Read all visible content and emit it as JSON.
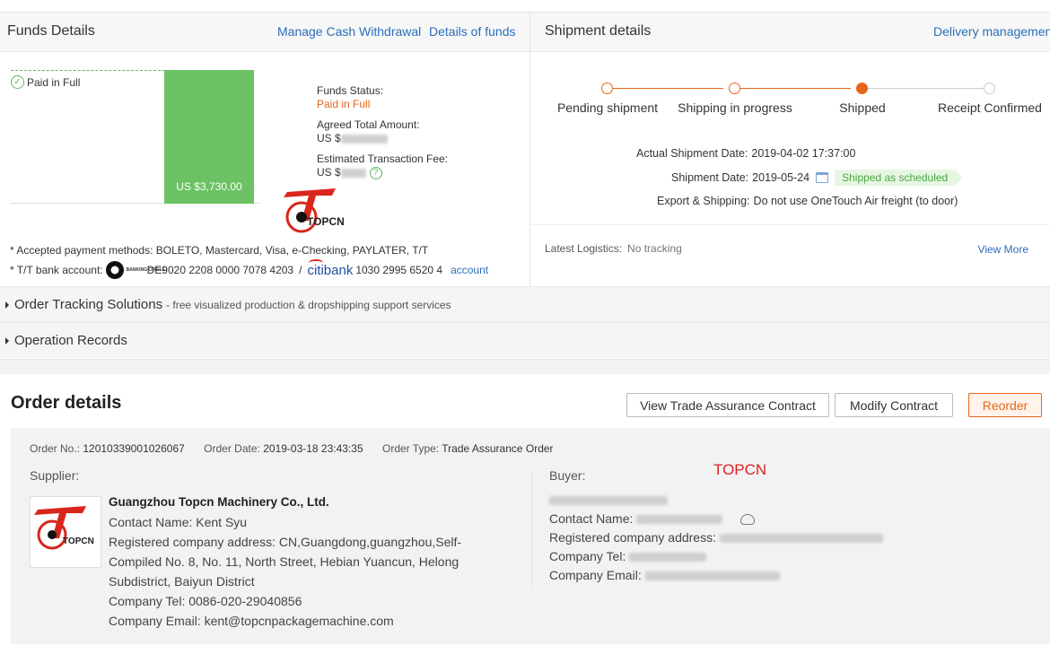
{
  "funds": {
    "title": "Funds Details",
    "link_withdrawal": "Manage Cash Withdrawal",
    "link_details": "Details of funds",
    "paid_badge": "Paid in Full",
    "bar_label": "US $3,730.00",
    "status_label": "Funds Status:",
    "status_value": "Paid in Full",
    "agreed_label": "Agreed Total Amount:",
    "agreed_prefix": "US $",
    "fee_label": "Estimated Transaction Fee:",
    "fee_prefix": "US $",
    "logo_text": "TOPCN",
    "payment_methods": "* Accepted payment methods: BOLETO, Mastercard, Visa, e-Checking, PAYLATER, T/T",
    "bank_label": "* T/T bank account:",
    "banking_circle": "BANKING CIRCLE",
    "iban": "DE9020 2208 0000 7078 4203",
    "bank_sep": "/",
    "citibank": "citibank",
    "citi_acct": "1030 2995 6520 4",
    "account_link": "account"
  },
  "shipment": {
    "title": "Shipment details",
    "link_delivery": "Delivery management",
    "steps": [
      "Pending shipment",
      "Shipping in progress",
      "Shipped",
      "Receipt Confirmed"
    ],
    "actual_label": "Actual Shipment Date:",
    "actual_value": "2019-04-02 17:37:00",
    "date_label": "Shipment Date:",
    "date_value": "2019-05-24",
    "scheduled_badge": "Shipped as scheduled",
    "export_label": "Export & Shipping:",
    "export_value": "Do not use OneTouch Air freight (to door)",
    "logistics_label": "Latest Logistics:",
    "logistics_value": "No tracking",
    "view_more": "View More"
  },
  "sections": {
    "tracking_title": "Order Tracking Solutions",
    "tracking_sub": "- free visualized production & dropshipping support services",
    "records_title": "Operation Records"
  },
  "order": {
    "title": "Order details",
    "btn_view_contract": "View Trade Assurance Contract",
    "btn_modify": "Modify Contract",
    "btn_reorder": "Reorder",
    "no_label": "Order No.:",
    "no_value": "12010339001026067",
    "date_label": "Order Date:",
    "date_value": "2019-03-18 23:43:35",
    "type_label": "Order Type:",
    "type_value": "Trade Assurance Order",
    "supplier_label": "Supplier:",
    "supplier_name": "Guangzhou Topcn Machinery Co., Ltd.",
    "supplier_logo_text": "TOPCN",
    "contact_label": "Contact Name:",
    "contact_value": "Kent Syu",
    "address_label": "Registered company address:",
    "address_value": "CN,Guangdong,guangzhou,Self-Compiled No. 8, No. 11, North Street, Hebian Yuancun, Helong Subdistrict, Baiyun District",
    "tel_label": "Company Tel:",
    "tel_value": "0086-020-29040856",
    "email_label": "Company Email:",
    "email_value": "kent@topcnpackagemachine.com",
    "buyer_label": "Buyer:",
    "buyer_watermark": "TOPCN",
    "buyer_contact_label": "Contact Name:",
    "buyer_address_label": "Registered company address:",
    "buyer_tel_label": "Company Tel:",
    "buyer_email_label": "Company Email:"
  },
  "colors": {
    "accent_orange": "#e5661a",
    "link_blue": "#2a6ebb",
    "bar_green": "#6cc164"
  }
}
